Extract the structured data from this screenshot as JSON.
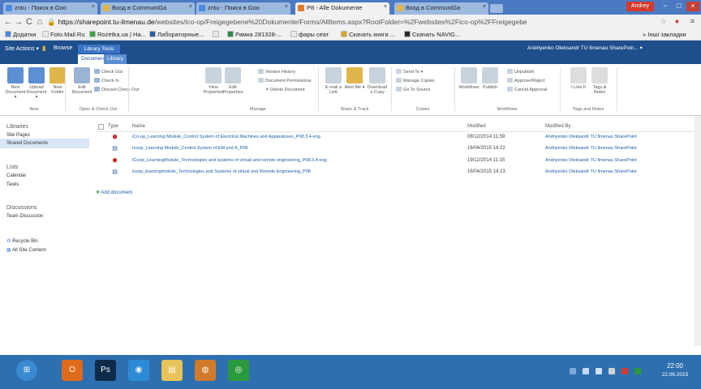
{
  "browser": {
    "tabs": [
      {
        "title": "zntu - Поиск в Goo"
      },
      {
        "title": "Вход в CommuniGa"
      },
      {
        "title": "zntu - Поиск в Goo"
      },
      {
        "title": "P8 - Alle Dokumente"
      },
      {
        "title": "Вход в CommuniGa"
      }
    ],
    "user_label": "Andrey",
    "window_controls": [
      "−",
      "□",
      "×"
    ],
    "url_host": "https://sharepoint.tu-ilmenau.de",
    "url_path": "/websites/ico-op/Freigegebene%20Dokumente/Forms/AllItems.aspx?RootFolder=%2Fwebsites%2Fico-op%2FFreigegebe",
    "bookmarks": [
      {
        "label": "Додатки",
        "color": "#4c8be0"
      },
      {
        "label": "Foto.Mail.Ru",
        "color": "#e9e9e9"
      },
      {
        "label": "Rozetka.ua | На...",
        "color": "#3fa544"
      },
      {
        "label": "Лабораторные...",
        "color": "#2c5fa5"
      },
      {
        "label": "",
        "color": "#e9e9e9"
      },
      {
        "label": "Рамка 281328-...",
        "color": "#2c8a4a"
      },
      {
        "label": "фары сеат",
        "color": "#e9e9e9"
      },
      {
        "label": "Скачать книги ...",
        "color": "#d7a82a"
      },
      {
        "label": "Скачать NAVIG...",
        "color": "#2c2c2c"
      }
    ],
    "bookmarks_other": "Інші закладки"
  },
  "sharepoint": {
    "site_actions": "Site Actions ▾",
    "browse": "Browse",
    "library_tools": "Library Tools",
    "ribbon_tabs": [
      "Documents",
      "Library"
    ],
    "user_name": "Andriyenko Oleksandr TU Ilmenau SharePoin... ▾",
    "ribbon": {
      "big_buttons": [
        {
          "label": "New Document ▾",
          "color": "#5d8fd3"
        },
        {
          "label": "Upload Document ▾",
          "color": "#5d8fd3"
        },
        {
          "label": "New Folder",
          "color": "#e0b64a"
        },
        {
          "label": "Edit Document",
          "color": "#9bb4d3"
        },
        {
          "label": "View Properties",
          "color": "#c9d3de"
        },
        {
          "label": "Edit Properties",
          "color": "#c9d3de"
        },
        {
          "label": "E-mail a Link",
          "color": "#c9d3de"
        },
        {
          "label": "Alert Me ▾",
          "color": "#e0b64a"
        },
        {
          "label": "Download a Copy",
          "color": "#c9d3de"
        },
        {
          "label": "Workflows",
          "color": "#c9d3de"
        },
        {
          "label": "Publish",
          "color": "#c9d3de"
        },
        {
          "label": "I Like It",
          "color": "#dddddd"
        },
        {
          "label": "Tags & Notes",
          "color": "#dddddd"
        }
      ],
      "small_buttons": [
        {
          "label": "Check Out",
          "color": "#9bb4d3"
        },
        {
          "label": "Check In",
          "color": "#9bb4d3"
        },
        {
          "label": "Discard Check Out",
          "color": "#9bb4d3"
        },
        {
          "label": "Version History",
          "color": "#c9d3de"
        },
        {
          "label": "Document Permissions",
          "color": "#c9d3de"
        },
        {
          "label": "✕ Delete Document",
          "color": "#ffffff"
        },
        {
          "label": "Send To ▾",
          "color": "#c9d3de"
        },
        {
          "label": "Manage Copies",
          "color": "#c9d3de"
        },
        {
          "label": "Go To Source",
          "color": "#c9d3de"
        },
        {
          "label": "Unpublish",
          "color": "#c9d3de"
        },
        {
          "label": "Approve/Reject",
          "color": "#c9d3de"
        },
        {
          "label": "Cancel Approval",
          "color": "#c9d3de"
        }
      ],
      "groups": [
        "New",
        "Open & Check Out",
        "Manage",
        "Share & Track",
        "Copies",
        "Workflows",
        "Tags and Notes"
      ]
    },
    "nav": {
      "libraries_heading": "Libraries",
      "site_pages": "Site Pages",
      "shared_documents": "Shared Documents",
      "lists_heading": "Lists",
      "calendar": "Calendar",
      "tasks": "Tasks",
      "discussions_heading": "Discussions",
      "team_discussion": "Team Discussion",
      "recycle_bin": "Recycle Bin",
      "all_site_content": "All Site Content"
    },
    "list": {
      "col_type": "Type",
      "col_name": "Name",
      "col_modified": "Modified",
      "col_modified_by": "Modified By",
      "rows": [
        {
          "icon": "pdf",
          "name": "iCo-op_Learning Module_Control System of Electrical Machines and Apparatuses_P08.3.4-eng",
          "modified": "08/12/2014 11:59",
          "modified_by": "Andriyenko Oleksandr TU Ilmenau SharePoint"
        },
        {
          "icon": "word",
          "name": "Icoop_Learning Module_Control System of EM and A_P08",
          "modified": "16/04/2015 14:22",
          "modified_by": "Andriyenko Oleksandr TU Ilmenau SharePoint"
        },
        {
          "icon": "pdf",
          "name": "ICoop_LearningModule_Technologies and systems of virtual and remote engineering_P08.3.4-eng",
          "modified": "19/12/2014 11:15",
          "modified_by": "Andriyenko Oleksandr TU Ilmenau SharePoint"
        },
        {
          "icon": "word",
          "name": "icoop_learningmodule_Technologies and Systems of virtual and Remote Engineering_P08",
          "modified": "16/04/2015 14:23",
          "modified_by": "Andriyenko Oleksandr TU Ilmenau SharePoint"
        }
      ],
      "add_document": "Add document"
    }
  },
  "taskbar": {
    "items": [
      {
        "label": "⊞",
        "color": "#3a89d1"
      },
      {
        "label": "O",
        "color": "#e06a1c"
      },
      {
        "label": "Ps",
        "color": "#0e2b4a"
      },
      {
        "label": "◉",
        "color": "#2d8bd6"
      },
      {
        "label": "▤",
        "color": "#e8c35a"
      },
      {
        "label": "◍",
        "color": "#d17a2c"
      },
      {
        "label": "◎",
        "color": "#2b9a3f"
      }
    ],
    "time": "22:00",
    "date": "22.06.2015"
  },
  "colors": {
    "sp_blue": "#1e4f8c",
    "link": "#1c5fa7",
    "pdf": "#c8302a",
    "word": "#2d5aa0"
  }
}
